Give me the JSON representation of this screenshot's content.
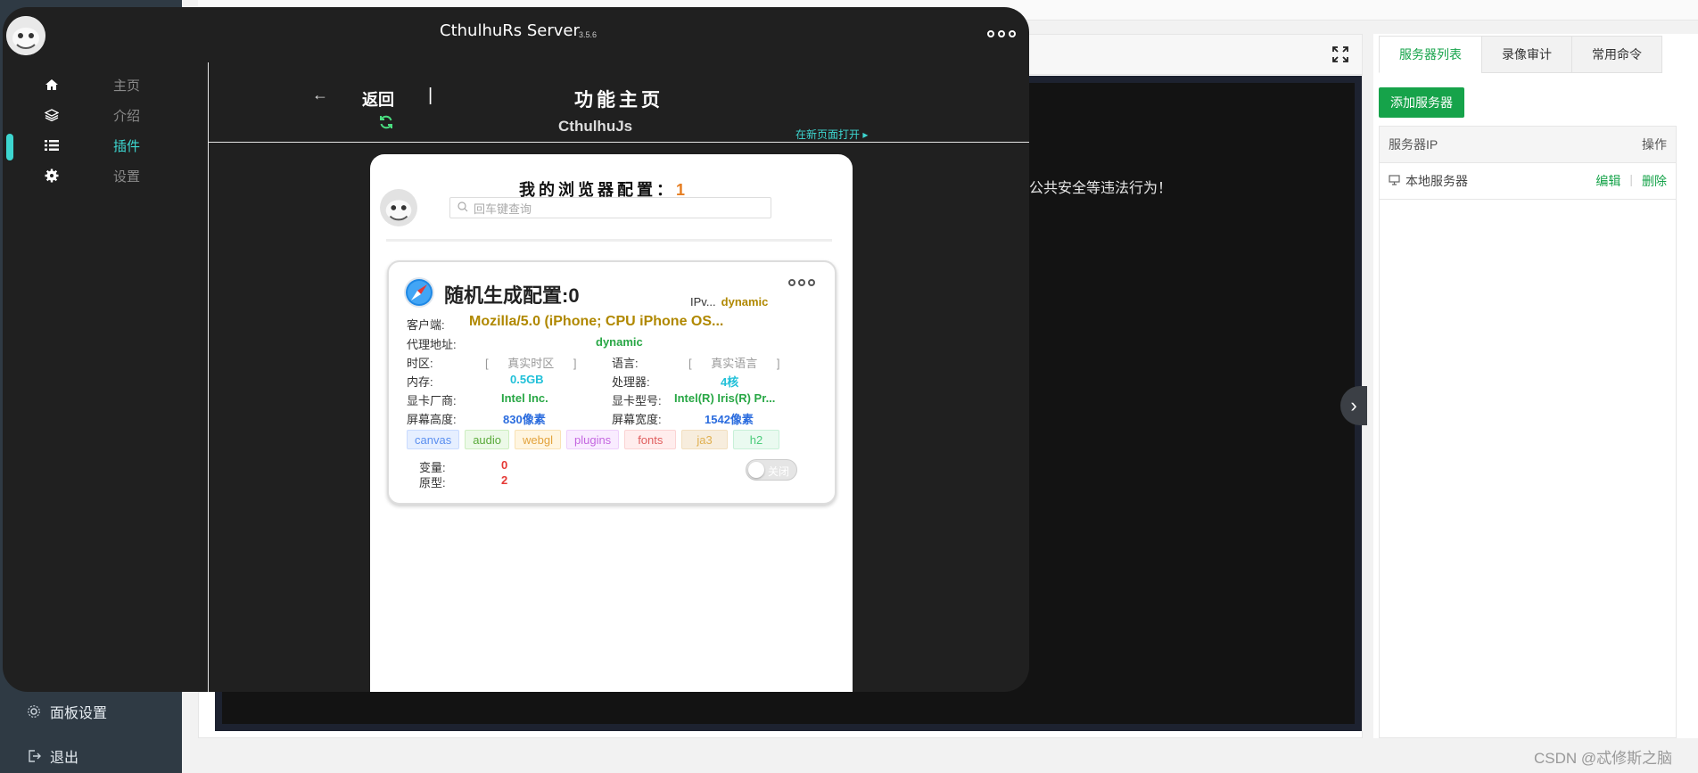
{
  "background": {
    "sidebar_bottom": [
      {
        "label": "面板设置",
        "icon": "gear-icon"
      },
      {
        "label": "退出",
        "icon": "logout-icon"
      }
    ],
    "terminal_text": "公共安全等违法行为！",
    "right_panel": {
      "tabs": [
        "服务器列表",
        "录像审计",
        "常用命令"
      ],
      "add_button": "添加服务器",
      "table_headers": {
        "ip": "服务器IP",
        "ops": "操作"
      },
      "rows": [
        {
          "name": "本地服务器",
          "edit": "编辑",
          "delete": "删除"
        }
      ]
    },
    "watermark": "CSDN @忒修斯之脑"
  },
  "overlay": {
    "title": "CthulhuRs Server",
    "version": "3.5.6",
    "nav": [
      {
        "label": "主页",
        "icon": "home-icon",
        "active": false
      },
      {
        "label": "介绍",
        "icon": "layers-icon",
        "active": false
      },
      {
        "label": "插件",
        "icon": "list-icon",
        "active": true
      },
      {
        "label": "设置",
        "icon": "gear-icon",
        "active": false
      }
    ],
    "header": {
      "back_label": "返回",
      "pipe": "|",
      "page_title": "功能主页",
      "sub_title": "CthulhuJs",
      "open_new_page": "在新页面打开 ▸"
    },
    "phone": {
      "heading": "我的浏览器配置：",
      "heading_count": "1",
      "search_placeholder": "回车键查询",
      "card": {
        "title": "随机生成配置:0",
        "ipv_label": "IPv...",
        "ipv_value": "dynamic",
        "client_label": "客户端:",
        "client_value": "Mozilla/5.0 (iPhone; CPU iPhone OS...",
        "proxy_label": "代理地址:",
        "proxy_value": "dynamic",
        "timezone_label": "时区:",
        "timezone_value": "真实时区",
        "language_label": "语言:",
        "language_value": "真实语言",
        "memory_label": "内存:",
        "memory_value": "0.5GB",
        "cpu_label": "处理器:",
        "cpu_value": "4核",
        "gpu_vendor_label": "显卡厂商:",
        "gpu_vendor_value": "Intel Inc.",
        "gpu_model_label": "显卡型号:",
        "gpu_model_value": "Intel(R) Iris(R) Pr...",
        "screen_height_label": "屏幕高度:",
        "screen_height_value": "830像素",
        "screen_width_label": "屏幕宽度:",
        "screen_width_value": "1542像素",
        "tags": [
          "canvas",
          "audio",
          "webgl",
          "plugins",
          "fonts",
          "ja3",
          "h2"
        ],
        "variable_label": "变量:",
        "variable_value": "0",
        "prototype_label": "原型:",
        "prototype_value": "2",
        "toggle_label": "关闭"
      }
    }
  }
}
